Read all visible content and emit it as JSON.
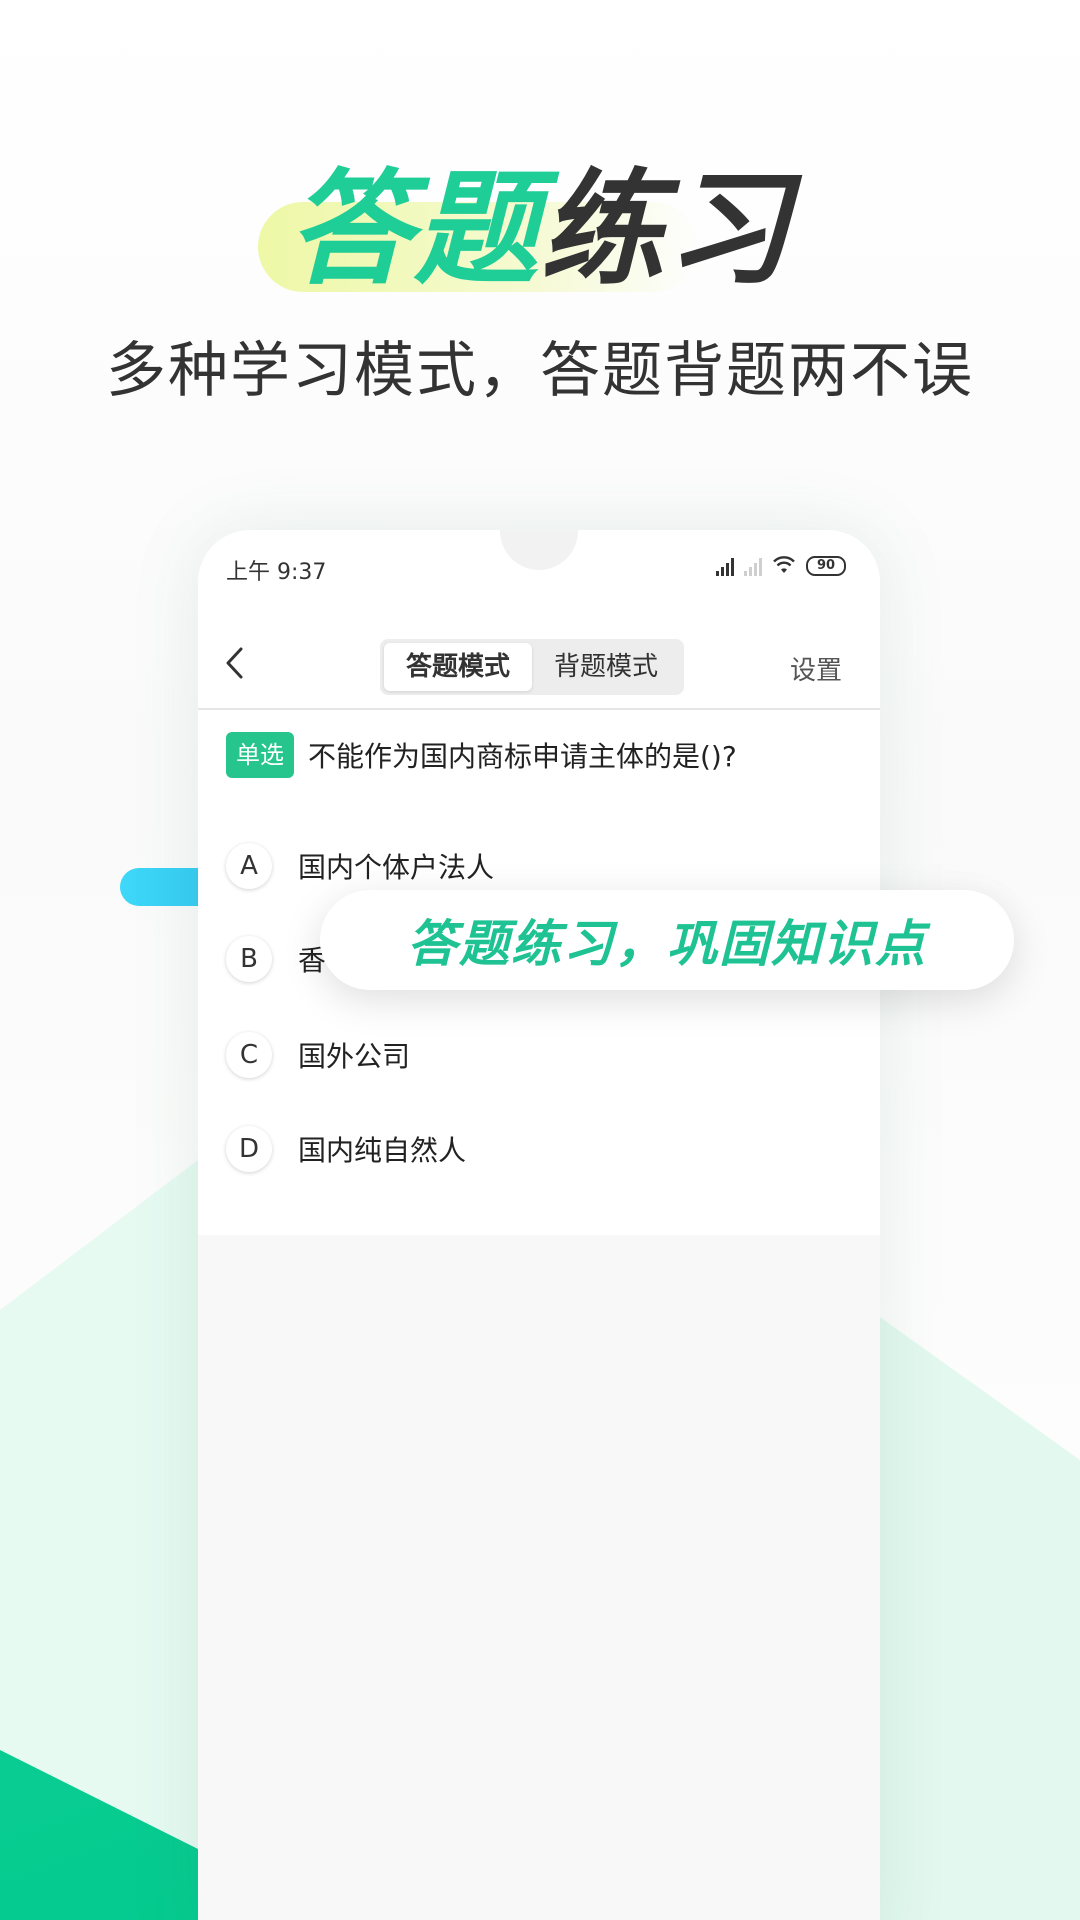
{
  "headline": {
    "part_green": "答题",
    "part_dark": "练习"
  },
  "subtitle": "多种学习模式，答题背题两不误",
  "status_bar": {
    "time": "上午 9:37",
    "battery": "90"
  },
  "nav": {
    "tabs": [
      {
        "label": "答题模式",
        "active": true
      },
      {
        "label": "背题模式",
        "active": false
      }
    ],
    "settings_label": "设置"
  },
  "question": {
    "type_badge": "单选",
    "text": "不能作为国内商标申请主体的是()?"
  },
  "options": [
    {
      "letter": "A",
      "text": "国内个体户法人"
    },
    {
      "letter": "B",
      "text": "香"
    },
    {
      "letter": "C",
      "text": "国外公司"
    },
    {
      "letter": "D",
      "text": "国内纯自然人"
    }
  ],
  "banner": {
    "text": "答题练习，巩固知识点"
  },
  "colors": {
    "accent": "#1fcd97",
    "badge": "#26c58e",
    "blue_pill": "#3fd8f8",
    "highlight": "#eef8a6"
  }
}
